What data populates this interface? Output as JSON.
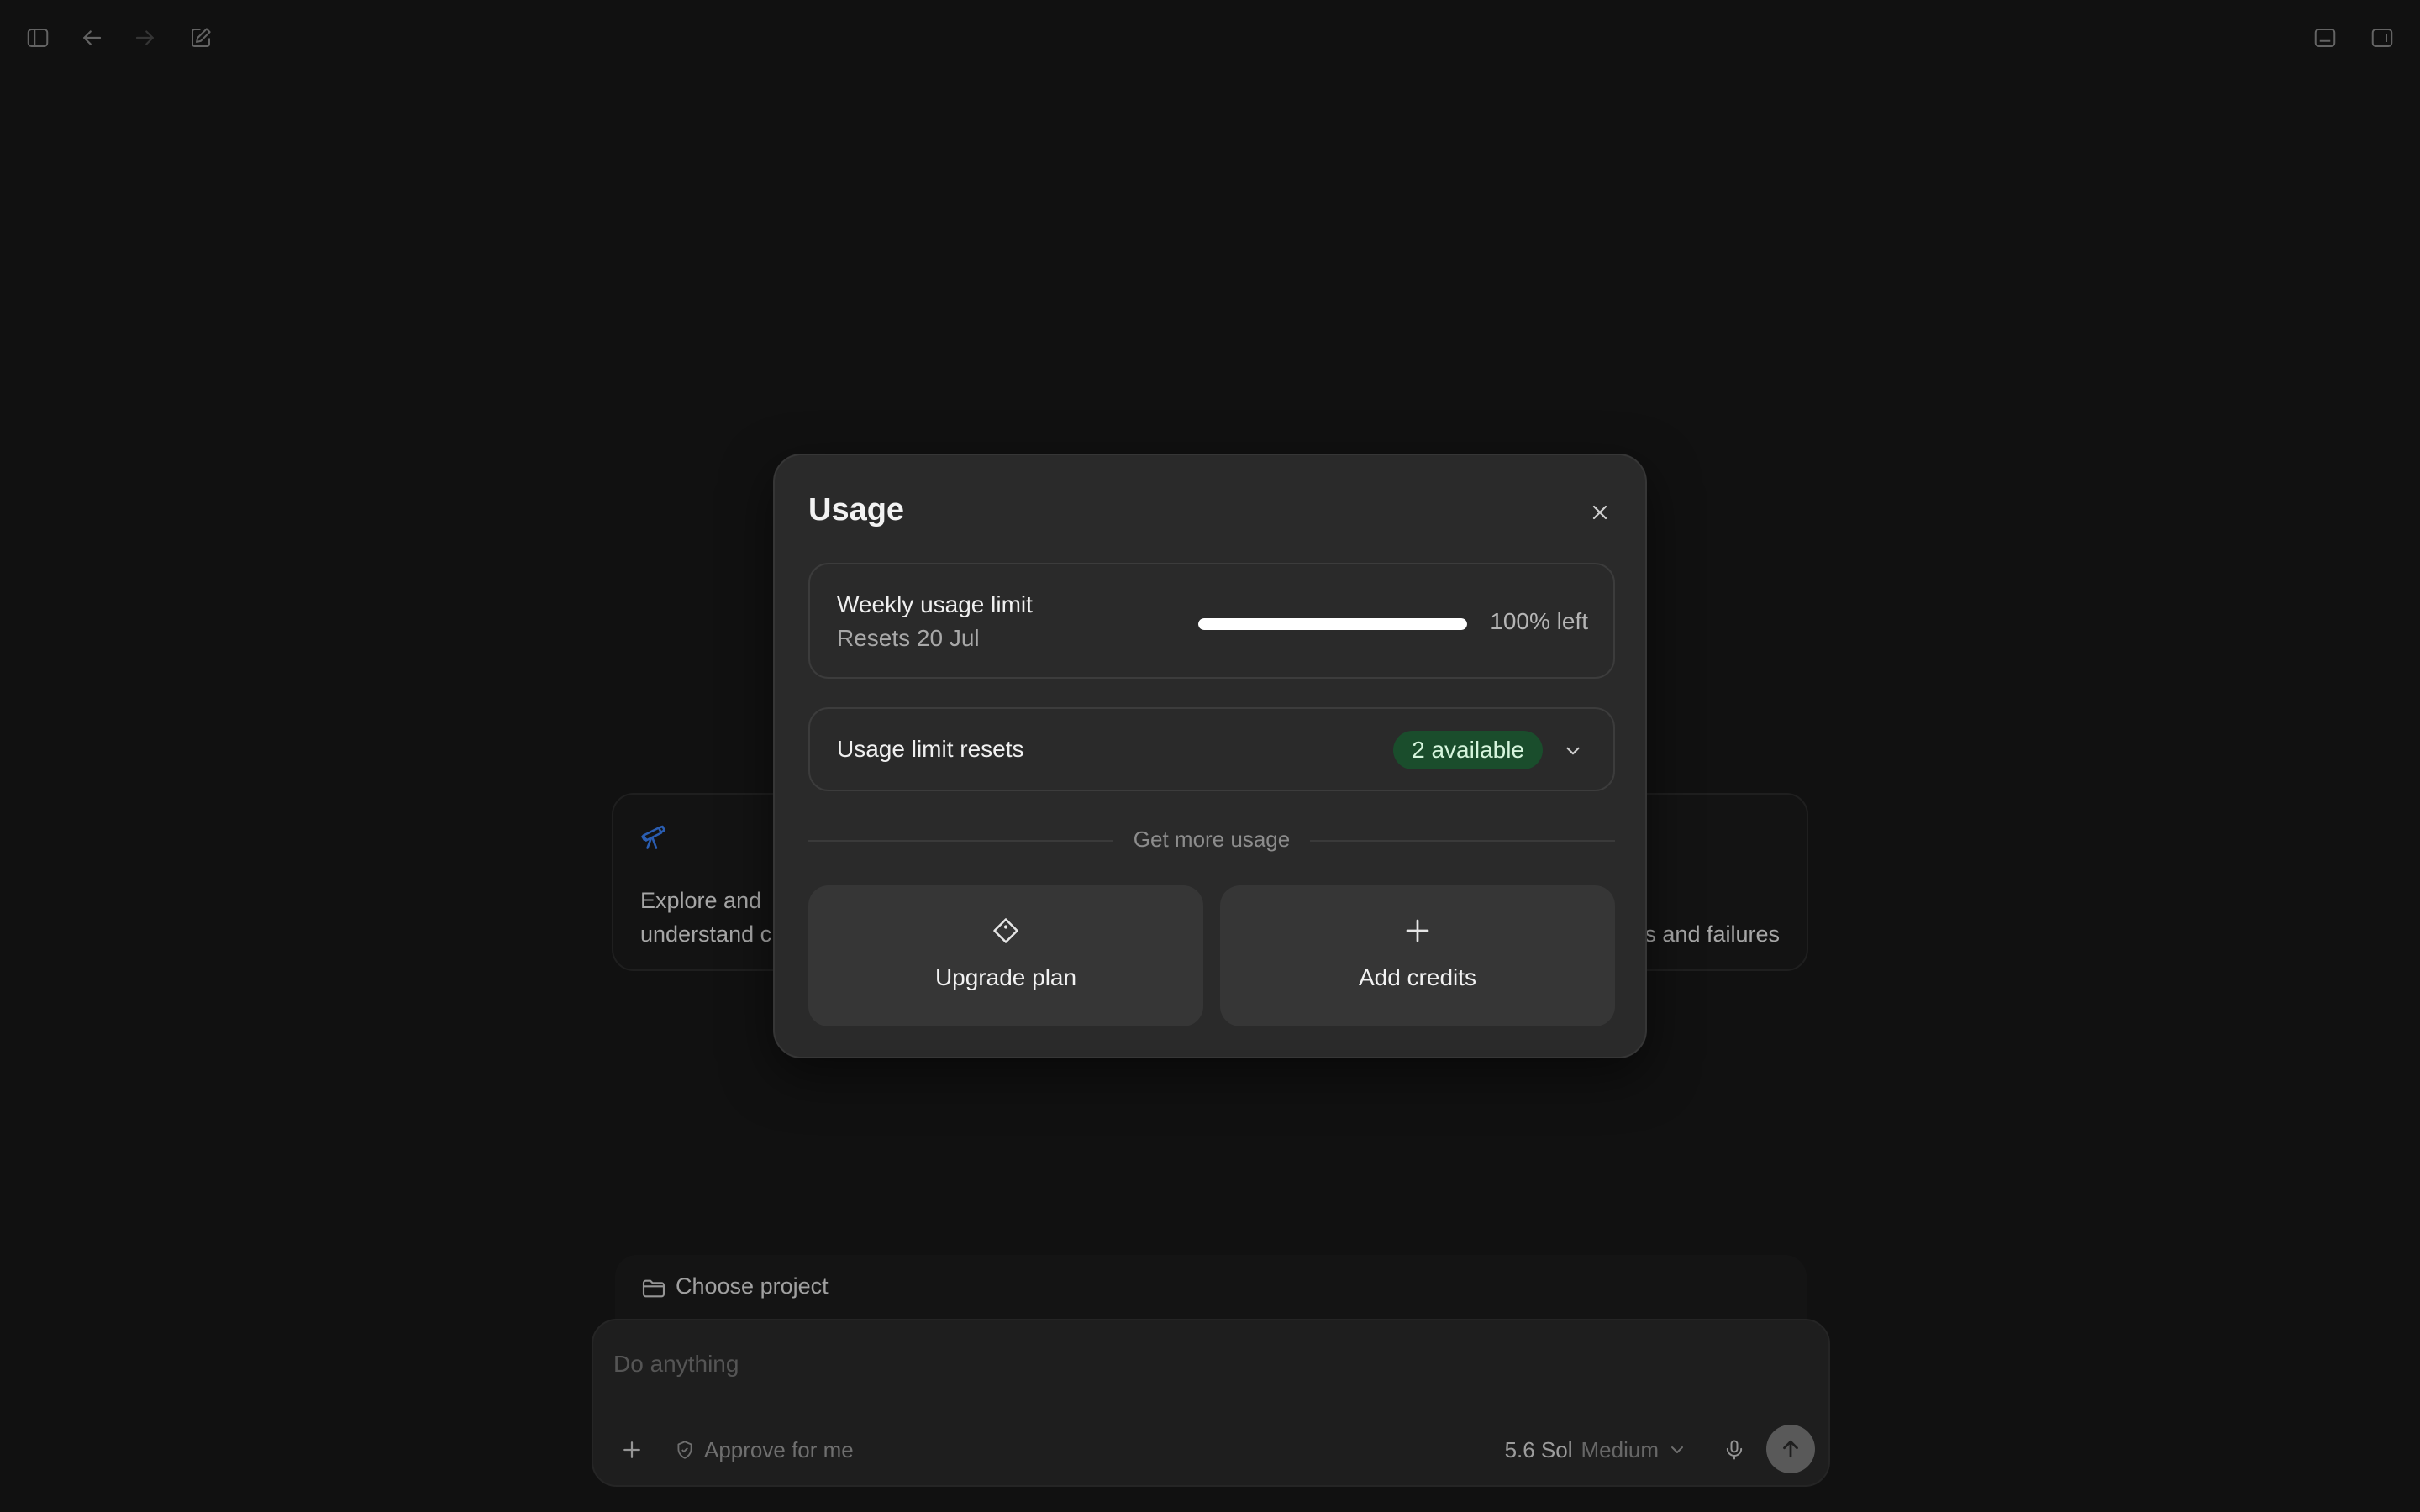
{
  "toolbar": {
    "left_icons": [
      "sidebar-toggle-icon",
      "back-arrow-icon",
      "forward-arrow-icon",
      "new-chat-icon"
    ],
    "right_icons": [
      "bottom-panel-icon",
      "right-panel-icon"
    ]
  },
  "cards": {
    "left": {
      "icon": "telescope-icon",
      "line1": "Explore and",
      "line2": "understand c",
      "icon_color": "#3b82f6"
    },
    "right": {
      "line2": "s and failures"
    }
  },
  "composer": {
    "project_label": "Choose project",
    "placeholder": "Do anything",
    "approve_label": "Approve for me",
    "model_name": "5.6 Sol",
    "model_level": "Medium"
  },
  "modal": {
    "title": "Usage",
    "weekly": {
      "label": "Weekly usage limit",
      "reset_text": "Resets 20 Jul",
      "remaining_fraction": 1.0,
      "remaining_text": "100% left"
    },
    "resets": {
      "label": "Usage limit resets",
      "badge": "2 available",
      "badge_color": "#1a4d2c"
    },
    "divider_text": "Get more usage",
    "actions": [
      {
        "label": "Upgrade plan",
        "icon": "tag-icon"
      },
      {
        "label": "Add credits",
        "icon": "plus-icon"
      }
    ]
  },
  "colors": {
    "background": "#181818",
    "modal": "#2a2a2a",
    "accent_green": "#1a4d2c"
  }
}
